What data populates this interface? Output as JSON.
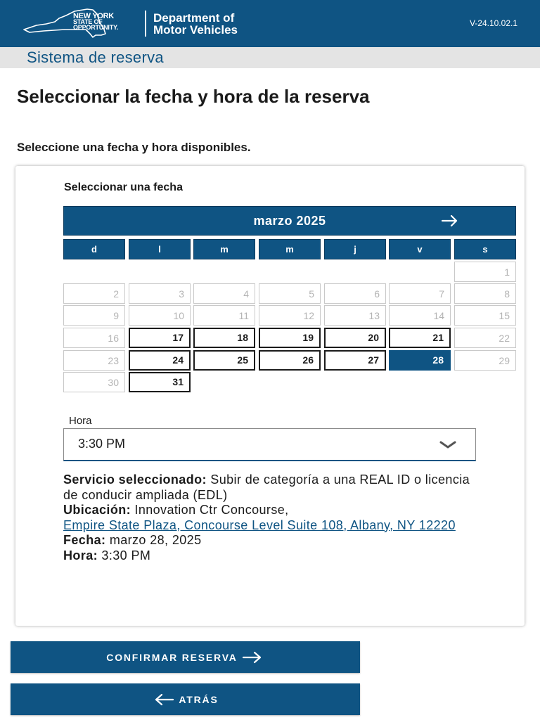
{
  "header": {
    "logo_line1": "NEW YORK",
    "logo_line2": "STATE OF",
    "logo_line3": "OPPORTUNITY.",
    "dept_line1": "Department of",
    "dept_line2": "Motor Vehicles",
    "version": "V-24.10.02.1"
  },
  "subheader": {
    "title": "Sistema de reserva"
  },
  "page": {
    "title": "Seleccionar la fecha y hora de la reserva",
    "subtitle": "Seleccione una fecha y hora disponibles."
  },
  "calendar": {
    "label": "Seleccionar una fecha",
    "month": "marzo 2025",
    "weekdays": [
      "d",
      "l",
      "m",
      "m",
      "j",
      "v",
      "s"
    ],
    "days": [
      {
        "n": "1",
        "state": "disabled"
      },
      {
        "n": "2",
        "state": "disabled"
      },
      {
        "n": "3",
        "state": "disabled"
      },
      {
        "n": "4",
        "state": "disabled"
      },
      {
        "n": "5",
        "state": "disabled"
      },
      {
        "n": "6",
        "state": "disabled"
      },
      {
        "n": "7",
        "state": "disabled"
      },
      {
        "n": "8",
        "state": "disabled"
      },
      {
        "n": "9",
        "state": "disabled"
      },
      {
        "n": "10",
        "state": "disabled"
      },
      {
        "n": "11",
        "state": "disabled"
      },
      {
        "n": "12",
        "state": "disabled"
      },
      {
        "n": "13",
        "state": "disabled"
      },
      {
        "n": "14",
        "state": "disabled"
      },
      {
        "n": "15",
        "state": "disabled"
      },
      {
        "n": "16",
        "state": "disabled"
      },
      {
        "n": "17",
        "state": "available"
      },
      {
        "n": "18",
        "state": "available"
      },
      {
        "n": "19",
        "state": "available"
      },
      {
        "n": "20",
        "state": "available"
      },
      {
        "n": "21",
        "state": "available"
      },
      {
        "n": "22",
        "state": "disabled"
      },
      {
        "n": "23",
        "state": "disabled"
      },
      {
        "n": "24",
        "state": "available"
      },
      {
        "n": "25",
        "state": "available"
      },
      {
        "n": "26",
        "state": "available"
      },
      {
        "n": "27",
        "state": "available"
      },
      {
        "n": "28",
        "state": "selected"
      },
      {
        "n": "29",
        "state": "disabled"
      },
      {
        "n": "30",
        "state": "disabled"
      },
      {
        "n": "31",
        "state": "available"
      }
    ]
  },
  "time": {
    "label": "Hora",
    "value": "3:30 PM"
  },
  "summary": {
    "service_label": "Servicio seleccionado:",
    "service_value": "Subir de categoría a una REAL ID o licencia de conducir ampliada (EDL)",
    "location_label": "Ubicación:",
    "location_value": "Innovation Ctr Concourse,",
    "location_link": "Empire State Plaza, Concourse Level Suite 108, Albany, NY 12220",
    "date_label": "Fecha:",
    "date_value": "marzo 28, 2025",
    "time_label": "Hora:",
    "time_value": "3:30 PM"
  },
  "buttons": {
    "confirm": "CONFIRMAR RESERVA",
    "back": "ATRÁS"
  },
  "colors": {
    "primary": "#0f5483",
    "subheader_bg": "#e4e4e4",
    "disabled_text": "#b4b4b4"
  },
  "icons": {
    "next_month": "arrow-right-icon",
    "time_dropdown": "chevron-down-icon",
    "confirm": "arrow-right-icon",
    "back": "arrow-left-icon",
    "logo": "new-york-state-map-icon"
  }
}
